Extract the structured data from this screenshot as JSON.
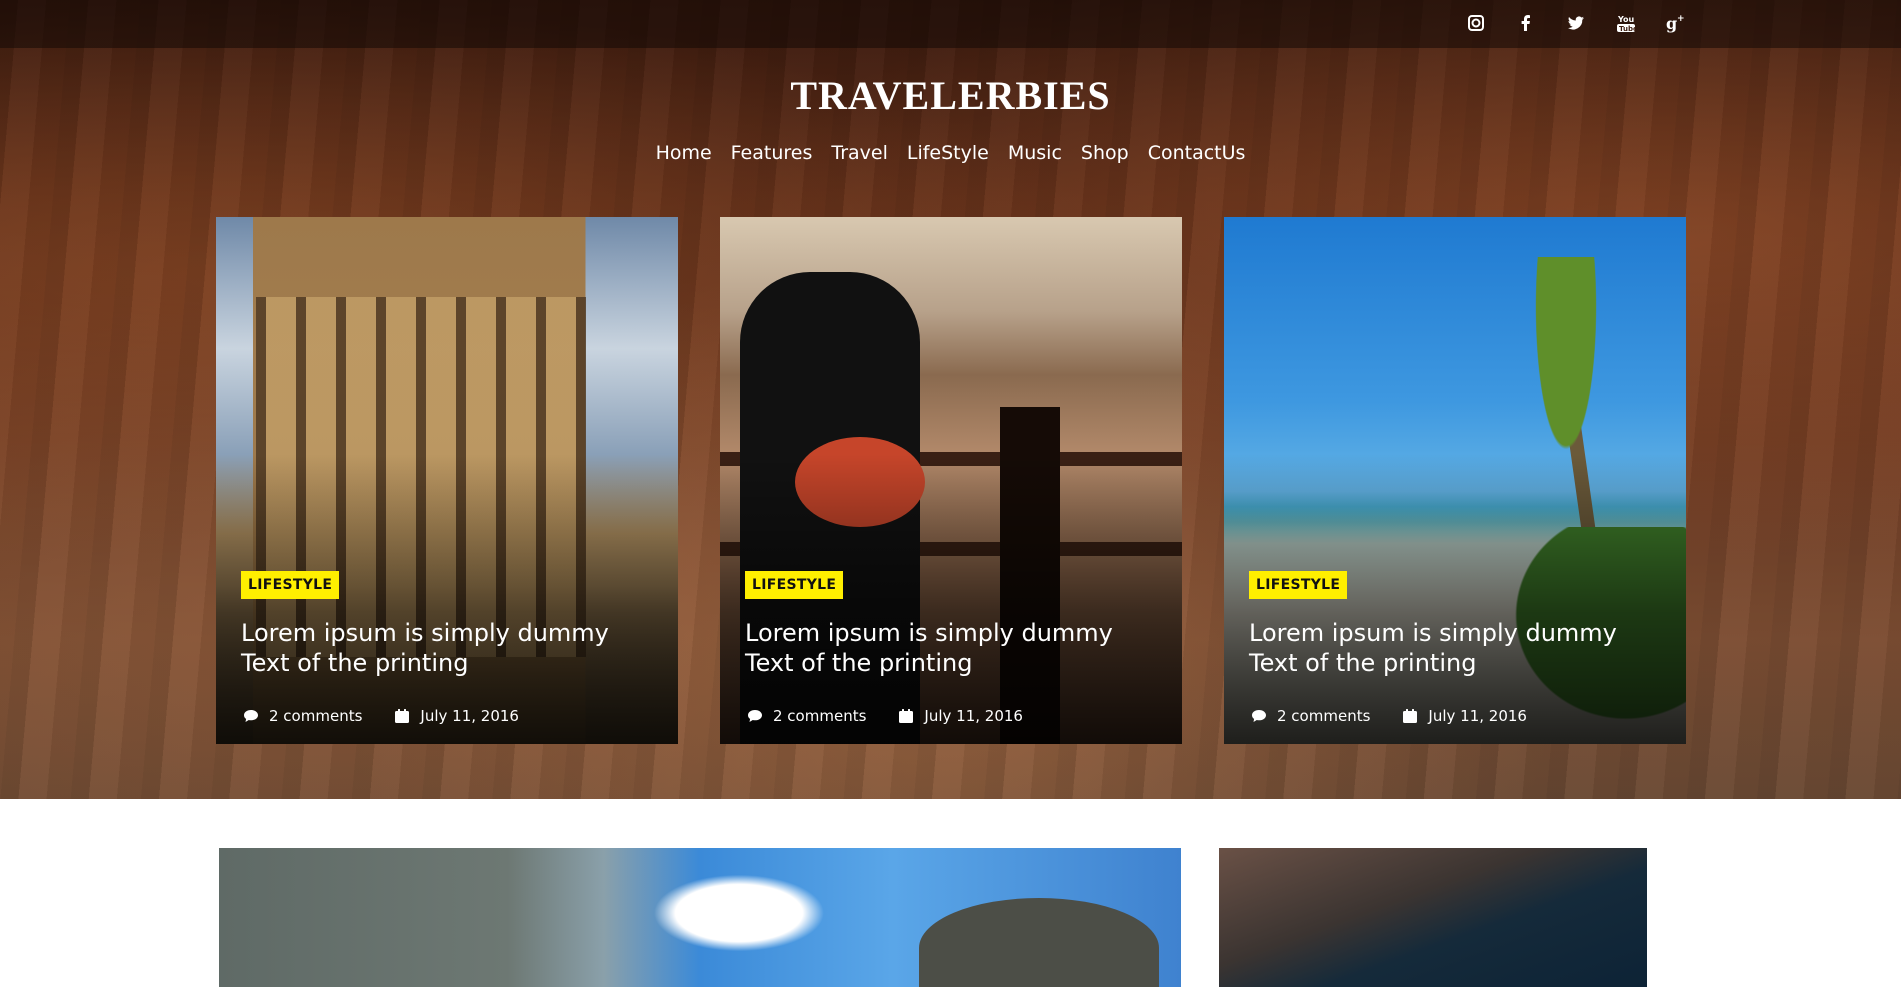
{
  "site": {
    "brand": "TRAVELERBIES"
  },
  "social": [
    {
      "name": "instagram-icon",
      "glyph": "◙"
    },
    {
      "name": "facebook-icon",
      "glyph": "f"
    },
    {
      "name": "twitter-icon",
      "glyph": "t"
    },
    {
      "name": "youtube-icon",
      "glyph": "You\nTube"
    },
    {
      "name": "google-plus-icon",
      "glyph": "g+"
    }
  ],
  "nav": {
    "items": [
      "Home",
      "Features",
      "Travel",
      "LifeStyle",
      "Music",
      "Shop",
      "ContactUs"
    ]
  },
  "cards": [
    {
      "category": "LIFESTYLE",
      "title": "Lorem ipsum is simply dummy Text of the printing",
      "comments": "2 comments",
      "date": "July 11, 2016"
    },
    {
      "category": "LIFESTYLE",
      "title": "Lorem ipsum is simply dummy Text of the printing",
      "comments": "2 comments",
      "date": "July 11, 2016"
    },
    {
      "category": "LIFESTYLE",
      "title": "Lorem ipsum is simply dummy Text of the printing",
      "comments": "2 comments",
      "date": "July 11, 2016"
    }
  ],
  "colors": {
    "badge": "#ffef00",
    "text": "#ffffff"
  }
}
